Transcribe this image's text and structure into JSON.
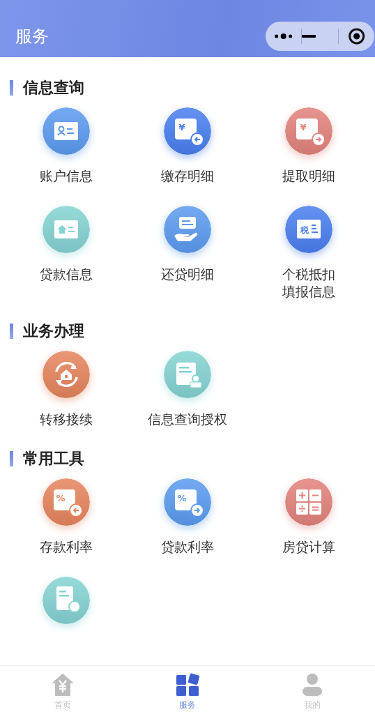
{
  "header": {
    "title": "服务"
  },
  "sections": [
    {
      "title": "信息查询",
      "items": [
        {
          "label": "账户信息",
          "kind": "card",
          "color": "#5b9bf0"
        },
        {
          "label": "缴存明细",
          "kind": "money-in",
          "glyph": "¥",
          "color": "#4a7ff0"
        },
        {
          "label": "提取明细",
          "kind": "money-out",
          "glyph": "¥",
          "color": "#e3827c"
        },
        {
          "label": "贷款信息",
          "kind": "house-card",
          "color": "#86d3d3"
        },
        {
          "label": "还贷明细",
          "kind": "hand",
          "color": "#5b9bf0"
        },
        {
          "label": "个税抵扣填报信息",
          "kind": "text-card",
          "glyph": "税",
          "color": "#4a7ff0"
        }
      ]
    },
    {
      "title": "业务办理",
      "items": [
        {
          "label": "转移接续",
          "kind": "transfer",
          "color": "#e6855e"
        },
        {
          "label": "信息查询授权",
          "kind": "stamp",
          "color": "#86d3d3"
        }
      ]
    },
    {
      "title": "常用工具",
      "items": [
        {
          "label": "存款利率",
          "kind": "money-in",
          "glyph": "%",
          "color": "#e6855e"
        },
        {
          "label": "贷款利率",
          "kind": "money-out",
          "glyph": "%",
          "color": "#5b9bf0"
        },
        {
          "label": "房贷计算",
          "kind": "calc",
          "color": "#e3827c"
        },
        {
          "kind": "doc",
          "color": "#86d3d3"
        }
      ]
    }
  ],
  "tabs": [
    {
      "label": "首页",
      "kind": "home",
      "selected": false
    },
    {
      "label": "服务",
      "kind": "grid",
      "selected": true
    },
    {
      "label": "我的",
      "kind": "person",
      "selected": false
    }
  ]
}
